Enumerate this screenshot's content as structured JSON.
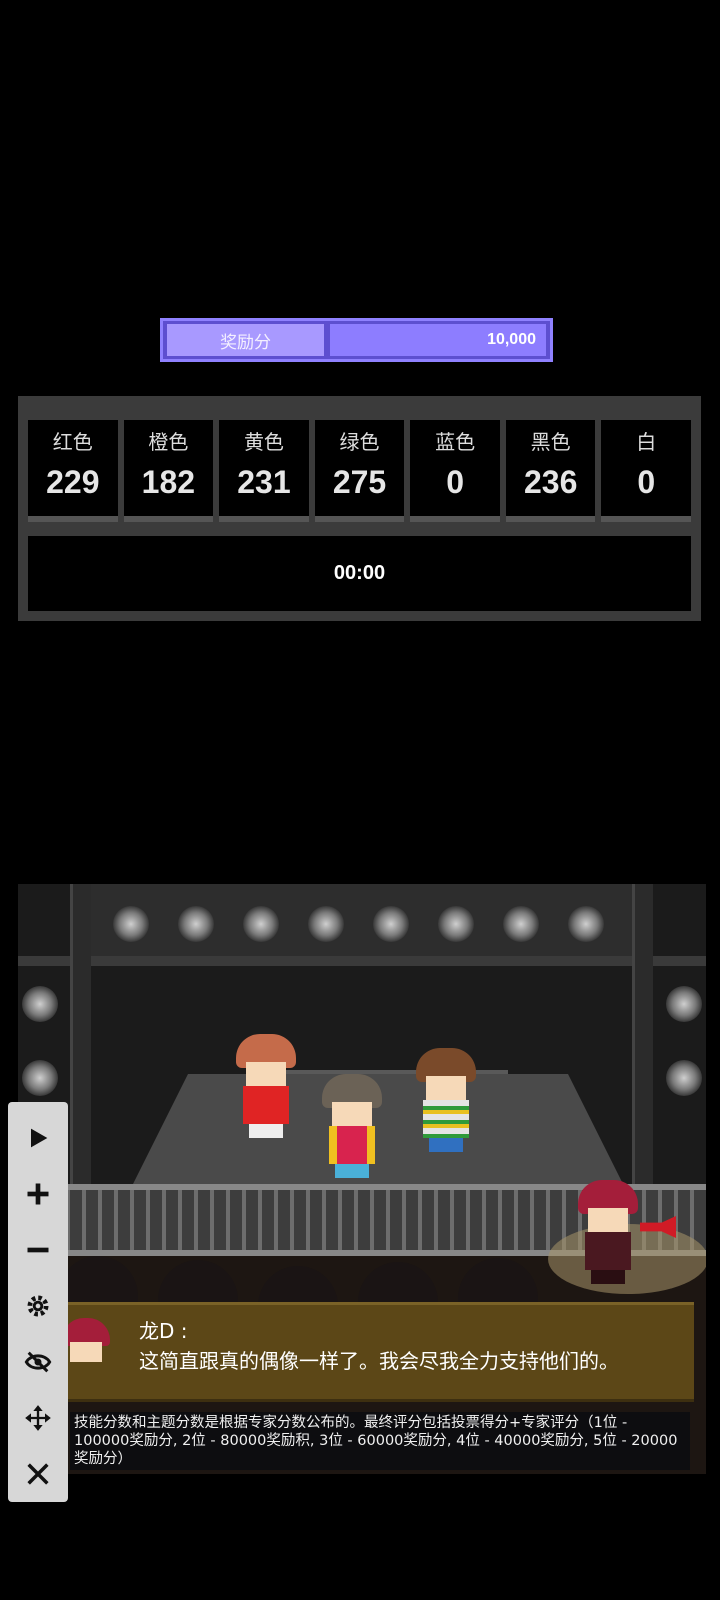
{
  "bonus": {
    "label": "奖励分",
    "value": "10,000"
  },
  "scores": [
    {
      "name": "红色",
      "value": "229"
    },
    {
      "name": "橙色",
      "value": "182"
    },
    {
      "name": "黄色",
      "value": "231"
    },
    {
      "name": "绿色",
      "value": "275"
    },
    {
      "name": "蓝色",
      "value": "0"
    },
    {
      "name": "黑色",
      "value": "236"
    },
    {
      "name": "白",
      "value": "0"
    }
  ],
  "timer": "00:00",
  "dialogue": {
    "speaker": "龙D :",
    "text": "这简直跟真的偶像一样了。我会尽我全力支持他们的。"
  },
  "info_text": "技能分数和主题分数是根据专家分数公布的。最终评分包括投票得分+专家评分（1位 - 100000奖励分, 2位 - 80000奖励积, 3位 - 60000奖励分, 4位 - 40000奖励分, 5位 - 20000奖励分）",
  "toolbar": {
    "play": "play-icon",
    "zoom_in": "plus-icon",
    "zoom_out": "minus-icon",
    "settings": "gear-icon",
    "hide": "eye-off-icon",
    "move": "move-icon",
    "close": "close-icon"
  },
  "colors": {
    "bonus_bar": "#8d7dff",
    "dialog_bg": "#5c4717",
    "board_bg": "#3b3b3b"
  }
}
